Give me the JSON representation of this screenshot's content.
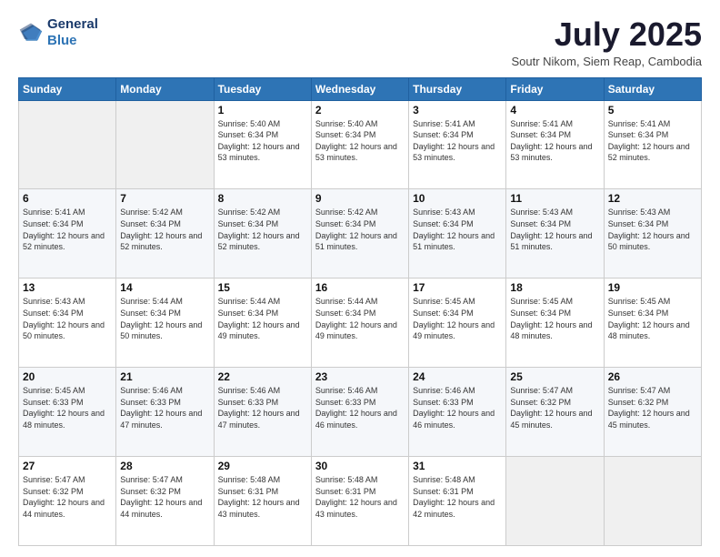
{
  "header": {
    "logo_line1": "General",
    "logo_line2": "Blue",
    "month_title": "July 2025",
    "location": "Soutr Nikom, Siem Reap, Cambodia"
  },
  "weekdays": [
    "Sunday",
    "Monday",
    "Tuesday",
    "Wednesday",
    "Thursday",
    "Friday",
    "Saturday"
  ],
  "weeks": [
    [
      {
        "day": "",
        "info": ""
      },
      {
        "day": "",
        "info": ""
      },
      {
        "day": "1",
        "info": "Sunrise: 5:40 AM\nSunset: 6:34 PM\nDaylight: 12 hours and 53 minutes."
      },
      {
        "day": "2",
        "info": "Sunrise: 5:40 AM\nSunset: 6:34 PM\nDaylight: 12 hours and 53 minutes."
      },
      {
        "day": "3",
        "info": "Sunrise: 5:41 AM\nSunset: 6:34 PM\nDaylight: 12 hours and 53 minutes."
      },
      {
        "day": "4",
        "info": "Sunrise: 5:41 AM\nSunset: 6:34 PM\nDaylight: 12 hours and 53 minutes."
      },
      {
        "day": "5",
        "info": "Sunrise: 5:41 AM\nSunset: 6:34 PM\nDaylight: 12 hours and 52 minutes."
      }
    ],
    [
      {
        "day": "6",
        "info": "Sunrise: 5:41 AM\nSunset: 6:34 PM\nDaylight: 12 hours and 52 minutes."
      },
      {
        "day": "7",
        "info": "Sunrise: 5:42 AM\nSunset: 6:34 PM\nDaylight: 12 hours and 52 minutes."
      },
      {
        "day": "8",
        "info": "Sunrise: 5:42 AM\nSunset: 6:34 PM\nDaylight: 12 hours and 52 minutes."
      },
      {
        "day": "9",
        "info": "Sunrise: 5:42 AM\nSunset: 6:34 PM\nDaylight: 12 hours and 51 minutes."
      },
      {
        "day": "10",
        "info": "Sunrise: 5:43 AM\nSunset: 6:34 PM\nDaylight: 12 hours and 51 minutes."
      },
      {
        "day": "11",
        "info": "Sunrise: 5:43 AM\nSunset: 6:34 PM\nDaylight: 12 hours and 51 minutes."
      },
      {
        "day": "12",
        "info": "Sunrise: 5:43 AM\nSunset: 6:34 PM\nDaylight: 12 hours and 50 minutes."
      }
    ],
    [
      {
        "day": "13",
        "info": "Sunrise: 5:43 AM\nSunset: 6:34 PM\nDaylight: 12 hours and 50 minutes."
      },
      {
        "day": "14",
        "info": "Sunrise: 5:44 AM\nSunset: 6:34 PM\nDaylight: 12 hours and 50 minutes."
      },
      {
        "day": "15",
        "info": "Sunrise: 5:44 AM\nSunset: 6:34 PM\nDaylight: 12 hours and 49 minutes."
      },
      {
        "day": "16",
        "info": "Sunrise: 5:44 AM\nSunset: 6:34 PM\nDaylight: 12 hours and 49 minutes."
      },
      {
        "day": "17",
        "info": "Sunrise: 5:45 AM\nSunset: 6:34 PM\nDaylight: 12 hours and 49 minutes."
      },
      {
        "day": "18",
        "info": "Sunrise: 5:45 AM\nSunset: 6:34 PM\nDaylight: 12 hours and 48 minutes."
      },
      {
        "day": "19",
        "info": "Sunrise: 5:45 AM\nSunset: 6:34 PM\nDaylight: 12 hours and 48 minutes."
      }
    ],
    [
      {
        "day": "20",
        "info": "Sunrise: 5:45 AM\nSunset: 6:33 PM\nDaylight: 12 hours and 48 minutes."
      },
      {
        "day": "21",
        "info": "Sunrise: 5:46 AM\nSunset: 6:33 PM\nDaylight: 12 hours and 47 minutes."
      },
      {
        "day": "22",
        "info": "Sunrise: 5:46 AM\nSunset: 6:33 PM\nDaylight: 12 hours and 47 minutes."
      },
      {
        "day": "23",
        "info": "Sunrise: 5:46 AM\nSunset: 6:33 PM\nDaylight: 12 hours and 46 minutes."
      },
      {
        "day": "24",
        "info": "Sunrise: 5:46 AM\nSunset: 6:33 PM\nDaylight: 12 hours and 46 minutes."
      },
      {
        "day": "25",
        "info": "Sunrise: 5:47 AM\nSunset: 6:32 PM\nDaylight: 12 hours and 45 minutes."
      },
      {
        "day": "26",
        "info": "Sunrise: 5:47 AM\nSunset: 6:32 PM\nDaylight: 12 hours and 45 minutes."
      }
    ],
    [
      {
        "day": "27",
        "info": "Sunrise: 5:47 AM\nSunset: 6:32 PM\nDaylight: 12 hours and 44 minutes."
      },
      {
        "day": "28",
        "info": "Sunrise: 5:47 AM\nSunset: 6:32 PM\nDaylight: 12 hours and 44 minutes."
      },
      {
        "day": "29",
        "info": "Sunrise: 5:48 AM\nSunset: 6:31 PM\nDaylight: 12 hours and 43 minutes."
      },
      {
        "day": "30",
        "info": "Sunrise: 5:48 AM\nSunset: 6:31 PM\nDaylight: 12 hours and 43 minutes."
      },
      {
        "day": "31",
        "info": "Sunrise: 5:48 AM\nSunset: 6:31 PM\nDaylight: 12 hours and 42 minutes."
      },
      {
        "day": "",
        "info": ""
      },
      {
        "day": "",
        "info": ""
      }
    ]
  ]
}
